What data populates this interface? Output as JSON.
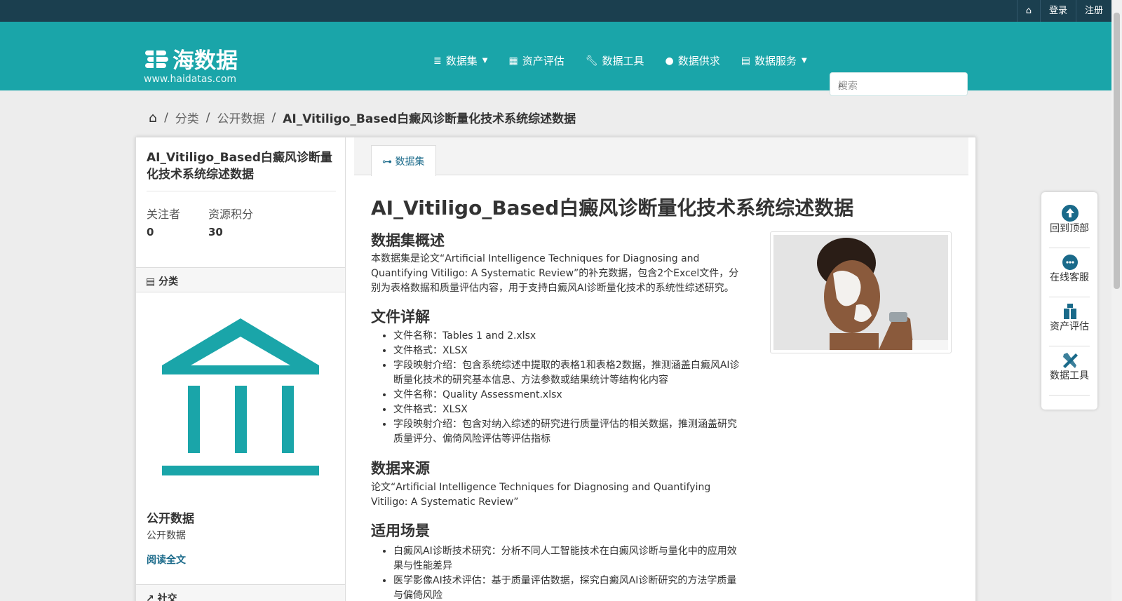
{
  "topbar": {
    "links": [
      {
        "label": "",
        "icon": "home-icon"
      },
      {
        "label": "登录"
      },
      {
        "label": "注册"
      }
    ]
  },
  "header": {
    "logo_text": "海数据",
    "logo_url": "www.haidatas.com",
    "nav": [
      {
        "label": "数据集",
        "icon": "database-icon",
        "dropdown": true
      },
      {
        "label": "资产评估",
        "icon": "calculator-icon",
        "dropdown": false
      },
      {
        "label": "数据工具",
        "icon": "wrench-icon",
        "dropdown": false
      },
      {
        "label": "数据供求",
        "icon": "comment-icon",
        "dropdown": false
      },
      {
        "label": "数据服务",
        "icon": "server-icon",
        "dropdown": true
      }
    ],
    "search_placeholder": "搜索"
  },
  "breadcrumb": {
    "items": [
      "分类",
      "公开数据"
    ],
    "current": "AI_Vitiligo_Based白癜风诊断量化技术系统综述数据"
  },
  "sidebar": {
    "title": "AI_Vitiligo_Based白癜风诊断量化技术系统综述数据",
    "followers_label": "关注者",
    "followers_value": "0",
    "points_label": "资源积分",
    "points_value": "30",
    "category_header": "分类",
    "category_name": "公开数据",
    "category_desc": "公开数据",
    "read_more": "阅读全文",
    "social_header": "社交"
  },
  "main": {
    "tab_label": "数据集",
    "title": "AI_Vitiligo_Based白癜风诊断量化技术系统综述数据",
    "overview_heading": "数据集概述",
    "overview_text": "本数据集是论文“Artificial Intelligence Techniques for Diagnosing and Quantifying Vitiligo: A Systematic Review”的补充数据，包含2个Excel文件，分别为表格数据和质量评估内容，用于支持白癜风AI诊断量化技术的系统性综述研究。",
    "files_heading": "文件详解",
    "files": [
      "文件名称：Tables 1 and 2.xlsx",
      "文件格式：XLSX",
      "字段映射介绍：包含系统综述中提取的表格1和表格2数据，推测涵盖白癜风AI诊断量化技术的研究基本信息、方法参数或结果统计等结构化内容",
      "文件名称：Quality Assessment.xlsx",
      "文件格式：XLSX",
      "字段映射介绍：包含对纳入综述的研究进行质量评估的相关数据，推测涵盖研究质量评分、偏倚风险评估等评估指标"
    ],
    "source_heading": "数据来源",
    "source_text": "论文“Artificial Intelligence Techniques for Diagnosing and Quantifying Vitiligo: A Systematic Review”",
    "usage_heading": "适用场景",
    "usage": [
      "白癜风AI诊断技术研究：分析不同人工智能技术在白癜风诊断与量化中的应用效果与性能差异",
      "医学影像AI技术评估：基于质量评估数据，探究白癜风AI诊断研究的方法学质量与偏倚风险"
    ]
  },
  "floater": [
    {
      "label": "回到顶部",
      "icon": "arrow-up-circle-icon"
    },
    {
      "label": "在线客服",
      "icon": "headset-icon"
    },
    {
      "label": "资产评估",
      "icon": "clipboard-icon"
    },
    {
      "label": "数据工具",
      "icon": "tools-icon"
    }
  ],
  "colors": {
    "topbar": "#1b3f4f",
    "header": "#1aa5a9",
    "accent": "#1a6a8a"
  }
}
